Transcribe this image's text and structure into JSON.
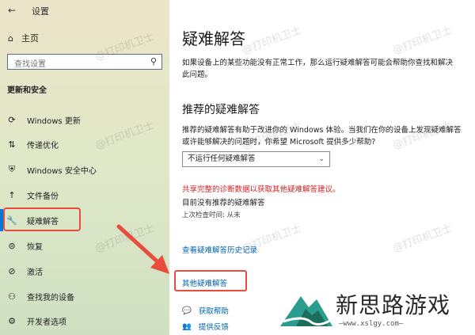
{
  "window": {
    "back_glyph": "←",
    "title": "设置"
  },
  "sidebar": {
    "home_label": "主页",
    "search_placeholder": "查找设置",
    "section_title": "更新和安全",
    "items": [
      {
        "label": "Windows 更新",
        "icon": "sync-icon"
      },
      {
        "label": "传递优化",
        "icon": "delivery-icon"
      },
      {
        "label": "Windows 安全中心",
        "icon": "shield-icon"
      },
      {
        "label": "文件备份",
        "icon": "backup-icon"
      },
      {
        "label": "疑难解答",
        "icon": "wrench-icon",
        "active": true
      },
      {
        "label": "恢复",
        "icon": "recovery-icon"
      },
      {
        "label": "激活",
        "icon": "check-circle-icon"
      },
      {
        "label": "查找我的设备",
        "icon": "person-locate-icon"
      },
      {
        "label": "开发者选项",
        "icon": "developer-icon"
      }
    ]
  },
  "main": {
    "title": "疑难解答",
    "intro": "如果设备上的某些功能没有正常工作，那么运行疑难解答可能会帮助你查找和解决此问题。",
    "rec_title": "推荐的疑难解答",
    "rec_desc": "推荐的疑难解答有助于改进你的 Windows 体验。当我们在你的设备上发现疑难解答或许能够解决的问题时，你希望 Microsoft 提供多少帮助?",
    "dropdown_value": "不运行任何疑难解答",
    "share_link": "共享完整的诊断数据以获取其他疑难解答建议。",
    "no_rec": "目前没有推荐的疑难解答",
    "last_check": "上次检查时间: 从未",
    "history_link": "查看疑难解答历史记录",
    "other_link": "其他疑难解答",
    "help": "获取帮助",
    "feedback": "提供反馈"
  },
  "watermark": "@打印机卫士",
  "logo": {
    "name": "新思路游戏",
    "url": "—www.xslgy.com—"
  },
  "colors": {
    "accent": "#0078d7",
    "highlight": "#e84c3d",
    "link": "#0063b1"
  }
}
